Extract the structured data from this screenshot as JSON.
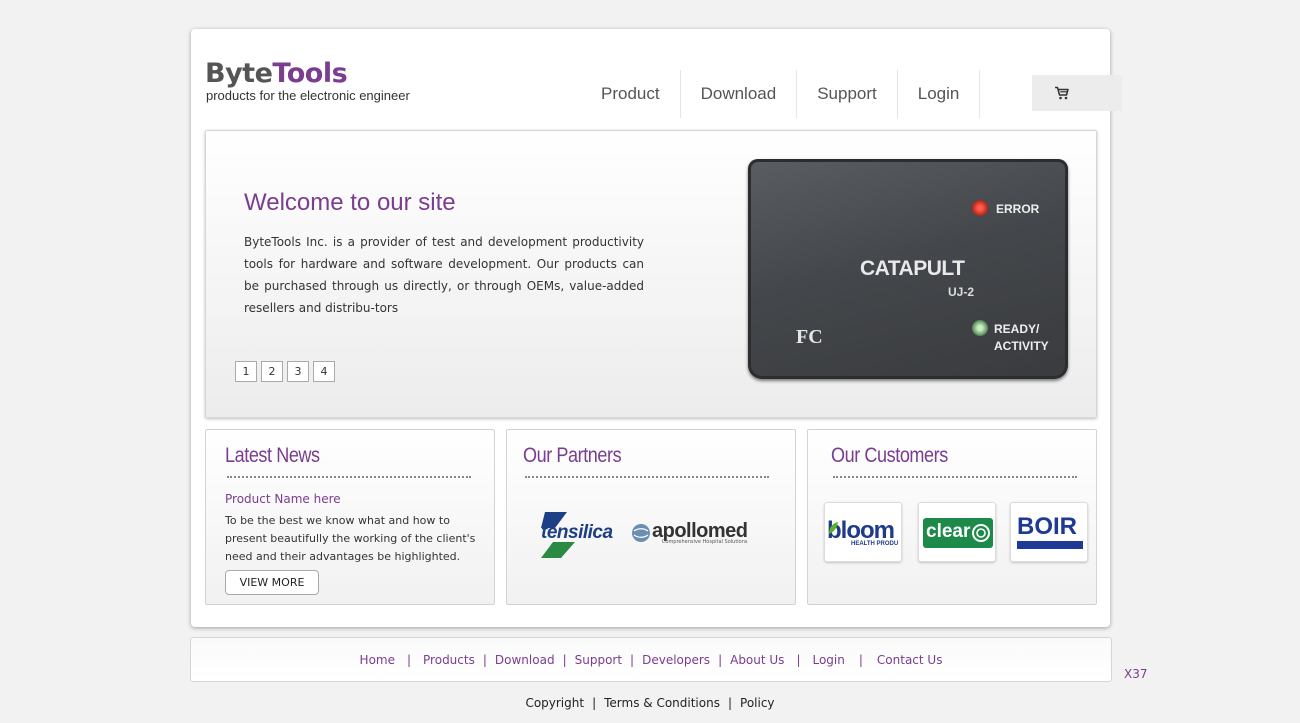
{
  "brand": {
    "name_part1": "Byte",
    "name_part2": "Tools",
    "tagline": "products for the electronic engineer",
    "accent_color": "#7a3d8f"
  },
  "nav": {
    "items": [
      {
        "label": "Product"
      },
      {
        "label": "Download"
      },
      {
        "label": "Support"
      },
      {
        "label": "Login"
      }
    ],
    "cart_icon": "shopping-cart-icon"
  },
  "hero": {
    "title": "Welcome to our site",
    "text": "ByteTools Inc. is a provider of test and development productivity tools for hardware and software development. Our products can be purchased through us directly, or through OEMs, value-added resellers and distribu-tors",
    "pager": [
      "1",
      "2",
      "3",
      "4"
    ],
    "device": {
      "name": "CATAPULT",
      "model": "UJ-2",
      "led_error_label": "ERROR",
      "led_ready_label": "READY/",
      "led_activity_label": "ACTIVITY",
      "cert_mark": "FC"
    }
  },
  "news": {
    "title": "Latest News",
    "item_title": "Product Name here",
    "item_text": "To be the best we know what and how to present beautifully the working of the client's need and their advantages be highlighted.",
    "button_label": "VIEW MORE"
  },
  "partners": {
    "title": "Our Partners",
    "logos": [
      {
        "text": "tensilica"
      },
      {
        "text": "apollomed",
        "subtext": "Comprehensive Hospital Solutions"
      }
    ]
  },
  "customers": {
    "title": "Our Customers",
    "logos": [
      {
        "text": "bloom",
        "subtext": "HEALTH PRODU"
      },
      {
        "text": "clear"
      },
      {
        "text": "BOIR"
      }
    ]
  },
  "footer": {
    "links": [
      "Home",
      "Products",
      "Download",
      "Support",
      "Developers",
      "About Us",
      "Login",
      "Contact Us"
    ],
    "separator": "|",
    "side_code": "X37",
    "bottom": [
      "Copyright",
      "Terms & Conditions",
      "Policy"
    ]
  }
}
